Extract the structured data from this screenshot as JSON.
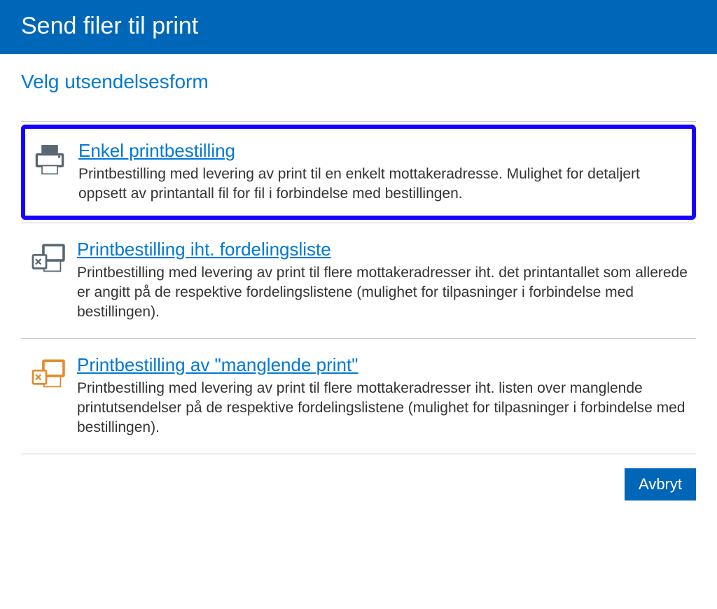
{
  "header": {
    "title": "Send filer til print"
  },
  "subtitle": "Velg utsendelsesform",
  "options": [
    {
      "title": "Enkel printbestilling",
      "description": "Printbestilling med levering av print til en enkelt mottakeradresse. Mulighet for detaljert oppsett av printantall fil for fil i forbindelse med bestillingen.",
      "icon": "printer-icon",
      "selected": true
    },
    {
      "title": "Printbestilling iht. fordelingsliste",
      "description": "Printbestilling med levering av print til flere mottakeradresser iht. det printantallet som allerede er angitt på de respektive fordelingslistene (mulighet for tilpasninger i forbindelse med bestillingen).",
      "icon": "distribution-list-icon",
      "selected": false
    },
    {
      "title": "Printbestilling av \"manglende print\"",
      "description": "Printbestilling med levering av print til flere mottakeradresser iht. listen over manglende printutsendelser på de respektive fordelingslistene (mulighet for tilpasninger i forbindelse med bestillingen).",
      "icon": "missing-print-icon",
      "selected": false
    }
  ],
  "footer": {
    "cancel_label": "Avbryt"
  }
}
